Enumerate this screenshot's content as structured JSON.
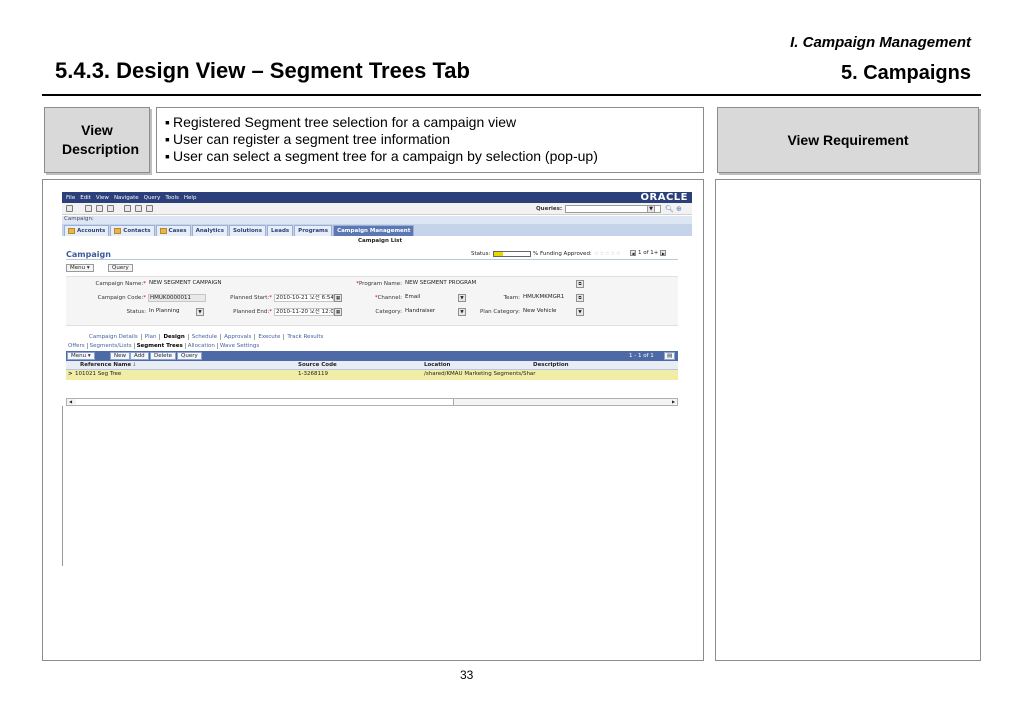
{
  "header": {
    "section": "I. Campaign Management",
    "title": "5.4.3. Design View – Segment Trees Tab",
    "chapter": "5. Campaigns"
  },
  "view_description": {
    "label": "View Description",
    "items": [
      "Registered Segment tree selection for a campaign view",
      "User can register a segment tree information",
      "User can select a segment tree for a campaign by selection (pop-up)"
    ]
  },
  "view_requirement": {
    "label": "View Requirement"
  },
  "page_number": "33",
  "app": {
    "menu": [
      "File",
      "Edit",
      "View",
      "Navigate",
      "Query",
      "Tools",
      "Help"
    ],
    "brand": "ORACLE",
    "queries_label": "Queries:",
    "breadcrumb": "Campaign:",
    "tabs": [
      "Accounts",
      "Contacts",
      "Cases",
      "Analytics",
      "Solutions",
      "Leads",
      "Programs",
      "Campaign Management"
    ],
    "subtitle": "Campaign List",
    "campaign_title": "Campaign",
    "status_label": "Status:",
    "status_fill": 0.26,
    "funding_label": "% Funding Approved:",
    "stars": "☆☆☆☆☆",
    "pager_text": "1 of 1+",
    "menu_btn": "Menu ▾",
    "query_btn": "Query",
    "form": {
      "campaign_name_label": "Campaign Name:",
      "campaign_name": "NEW SEGMENT CAMPAIGN",
      "program_name_label": "Program Name:",
      "program_name": "NEW SEGMENT PROGRAM",
      "campaign_code_label": "Campaign Code:",
      "campaign_code": "HMUK0000011",
      "planned_start_label": "Planned Start:",
      "planned_start": "2010-10-21 오전 6:54:",
      "channel_label": "Channel:",
      "channel": "Email",
      "team_label": "Team:",
      "team": "HMUKMKMGR1",
      "status_label": "Status:",
      "status": "In Planning",
      "planned_end_label": "Planned End:",
      "planned_end": "2010-11-20 오전 12:0",
      "category_label": "Category:",
      "category": "Handraiser",
      "plan_category_label": "Plan Category:",
      "plan_category": "New Vehicle"
    },
    "view_tabs": [
      "Campaign Details",
      "Plan",
      "Design",
      "Schedule",
      "Approvals",
      "Execute",
      "Track Results"
    ],
    "sub_views": [
      "Offers",
      "Segments/Lists",
      "Segment Trees",
      "Allocation",
      "Wave Settings"
    ],
    "list_buttons": [
      "Menu ▾",
      "New",
      "Add",
      "Delete",
      "Query"
    ],
    "list_count": "1 - 1 of 1",
    "columns": [
      "Reference Name",
      "Source Code",
      "Location",
      "Description"
    ],
    "sort_indicator": "↓",
    "rows": [
      {
        "reference_name": "101021 Seg Tree",
        "source_code": "1-3268119",
        "location": "/shared/KMAU Marketing Segments/Shar",
        "description": ""
      }
    ]
  }
}
